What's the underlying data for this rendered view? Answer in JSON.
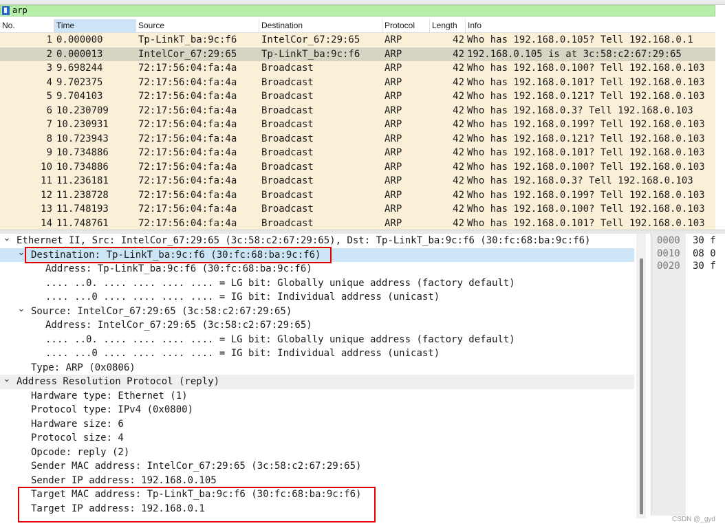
{
  "filter": {
    "value": "arp",
    "bg_color": "#b6f0a8"
  },
  "columns": [
    "No.",
    "Time",
    "Source",
    "Destination",
    "Protocol",
    "Length",
    "Info"
  ],
  "packets": [
    {
      "no": "1",
      "time": "0.000000",
      "src": "Tp-LinkT_ba:9c:f6",
      "dst": "IntelCor_67:29:65",
      "proto": "ARP",
      "len": "42",
      "info": "Who has 192.168.0.105? Tell 192.168.0.1"
    },
    {
      "no": "2",
      "time": "0.000013",
      "src": "IntelCor_67:29:65",
      "dst": "Tp-LinkT_ba:9c:f6",
      "proto": "ARP",
      "len": "42",
      "info": "192.168.0.105 is at 3c:58:c2:67:29:65",
      "selected": true
    },
    {
      "no": "3",
      "time": "9.698244",
      "src": "72:17:56:04:fa:4a",
      "dst": "Broadcast",
      "proto": "ARP",
      "len": "42",
      "info": "Who has 192.168.0.100? Tell 192.168.0.103"
    },
    {
      "no": "4",
      "time": "9.702375",
      "src": "72:17:56:04:fa:4a",
      "dst": "Broadcast",
      "proto": "ARP",
      "len": "42",
      "info": "Who has 192.168.0.101? Tell 192.168.0.103"
    },
    {
      "no": "5",
      "time": "9.704103",
      "src": "72:17:56:04:fa:4a",
      "dst": "Broadcast",
      "proto": "ARP",
      "len": "42",
      "info": "Who has 192.168.0.121? Tell 192.168.0.103"
    },
    {
      "no": "6",
      "time": "10.230709",
      "src": "72:17:56:04:fa:4a",
      "dst": "Broadcast",
      "proto": "ARP",
      "len": "42",
      "info": "Who has 192.168.0.3? Tell 192.168.0.103"
    },
    {
      "no": "7",
      "time": "10.230931",
      "src": "72:17:56:04:fa:4a",
      "dst": "Broadcast",
      "proto": "ARP",
      "len": "42",
      "info": "Who has 192.168.0.199? Tell 192.168.0.103"
    },
    {
      "no": "8",
      "time": "10.723943",
      "src": "72:17:56:04:fa:4a",
      "dst": "Broadcast",
      "proto": "ARP",
      "len": "42",
      "info": "Who has 192.168.0.121? Tell 192.168.0.103"
    },
    {
      "no": "9",
      "time": "10.734886",
      "src": "72:17:56:04:fa:4a",
      "dst": "Broadcast",
      "proto": "ARP",
      "len": "42",
      "info": "Who has 192.168.0.101? Tell 192.168.0.103"
    },
    {
      "no": "10",
      "time": "10.734886",
      "src": "72:17:56:04:fa:4a",
      "dst": "Broadcast",
      "proto": "ARP",
      "len": "42",
      "info": "Who has 192.168.0.100? Tell 192.168.0.103"
    },
    {
      "no": "11",
      "time": "11.236181",
      "src": "72:17:56:04:fa:4a",
      "dst": "Broadcast",
      "proto": "ARP",
      "len": "42",
      "info": "Who has 192.168.0.3? Tell 192.168.0.103"
    },
    {
      "no": "12",
      "time": "11.238728",
      "src": "72:17:56:04:fa:4a",
      "dst": "Broadcast",
      "proto": "ARP",
      "len": "42",
      "info": "Who has 192.168.0.199? Tell 192.168.0.103"
    },
    {
      "no": "13",
      "time": "11.748193",
      "src": "72:17:56:04:fa:4a",
      "dst": "Broadcast",
      "proto": "ARP",
      "len": "42",
      "info": "Who has 192.168.0.100? Tell 192.168.0.103"
    },
    {
      "no": "14",
      "time": "11.748761",
      "src": "72:17:56:04:fa:4a",
      "dst": "Broadcast",
      "proto": "ARP",
      "len": "42",
      "info": "Who has 192.168.0.101? Tell 192.168.0.103"
    }
  ],
  "details": [
    {
      "indent": 0,
      "toggle": true,
      "text": "Ethernet II, Src: IntelCor_67:29:65 (3c:58:c2:67:29:65), Dst: Tp-LinkT_ba:9c:f6 (30:fc:68:ba:9c:f6)"
    },
    {
      "indent": 1,
      "toggle": true,
      "text": "Destination: Tp-LinkT_ba:9c:f6 (30:fc:68:ba:9c:f6)",
      "highlight": true,
      "boxed": true
    },
    {
      "indent": 2,
      "toggle": false,
      "text": "Address: Tp-LinkT_ba:9c:f6 (30:fc:68:ba:9c:f6)"
    },
    {
      "indent": 2,
      "toggle": false,
      "text": ".... ..0. .... .... .... .... = LG bit: Globally unique address (factory default)"
    },
    {
      "indent": 2,
      "toggle": false,
      "text": ".... ...0 .... .... .... .... = IG bit: Individual address (unicast)"
    },
    {
      "indent": 1,
      "toggle": true,
      "text": "Source: IntelCor_67:29:65 (3c:58:c2:67:29:65)"
    },
    {
      "indent": 2,
      "toggle": false,
      "text": "Address: IntelCor_67:29:65 (3c:58:c2:67:29:65)"
    },
    {
      "indent": 2,
      "toggle": false,
      "text": ".... ..0. .... .... .... .... = LG bit: Globally unique address (factory default)"
    },
    {
      "indent": 2,
      "toggle": false,
      "text": ".... ...0 .... .... .... .... = IG bit: Individual address (unicast)"
    },
    {
      "indent": 1,
      "toggle": false,
      "text": "Type: ARP (0x0806)"
    },
    {
      "indent": 0,
      "toggle": true,
      "text": "Address Resolution Protocol (reply)",
      "section": true
    },
    {
      "indent": 1,
      "toggle": false,
      "text": "Hardware type: Ethernet (1)"
    },
    {
      "indent": 1,
      "toggle": false,
      "text": "Protocol type: IPv4 (0x0800)"
    },
    {
      "indent": 1,
      "toggle": false,
      "text": "Hardware size: 6"
    },
    {
      "indent": 1,
      "toggle": false,
      "text": "Protocol size: 4"
    },
    {
      "indent": 1,
      "toggle": false,
      "text": "Opcode: reply (2)"
    },
    {
      "indent": 1,
      "toggle": false,
      "text": "Sender MAC address: IntelCor_67:29:65 (3c:58:c2:67:29:65)"
    },
    {
      "indent": 1,
      "toggle": false,
      "text": "Sender IP address: 192.168.0.105"
    },
    {
      "indent": 1,
      "toggle": false,
      "text": "Target MAC address: Tp-LinkT_ba:9c:f6 (30:fc:68:ba:9c:f6)"
    },
    {
      "indent": 1,
      "toggle": false,
      "text": "Target IP address: 192.168.0.1"
    }
  ],
  "bytes": [
    {
      "offset": "0000",
      "hex": "30 f"
    },
    {
      "offset": "0010",
      "hex": "08 0"
    },
    {
      "offset": "0020",
      "hex": "30 f"
    }
  ],
  "watermark": "CSDN @_gyd",
  "colors": {
    "row_bg": "#faf0d7",
    "row_selected": "#d8d4c4",
    "detail_highlight": "#cce6f7",
    "annotation_box": "#e00000"
  }
}
